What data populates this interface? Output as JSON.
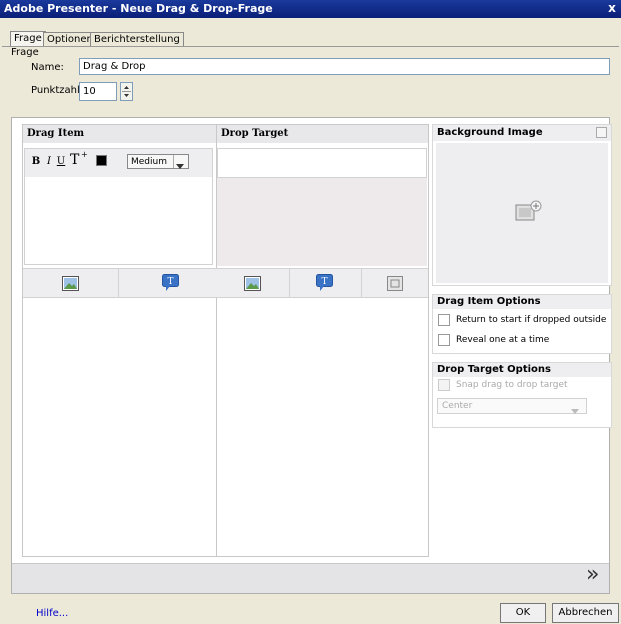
{
  "window": {
    "title": "Adobe Presenter - Neue Drag & Drop-Frage",
    "close_glyph": "x"
  },
  "tabs": [
    {
      "label": "Frage"
    },
    {
      "label": "Optionen"
    },
    {
      "label": "Berichterstellung"
    }
  ],
  "frage_group": {
    "legend": "Frage",
    "name_label": "Name:",
    "name_value": "Drag & Drop",
    "punkt_label": "Punktzahl:",
    "punkt_value": "10"
  },
  "drag_item": {
    "header": "Drag Item",
    "bold": "B",
    "italic": "I",
    "underline": "U",
    "textsize": "T",
    "textsize_sup": "+",
    "size_value": "Medium"
  },
  "drop_target": {
    "header": "Drop Target"
  },
  "right": {
    "bg_header": "Background Image",
    "drag_options_header": "Drag Item Options",
    "return_label": "Return to start if dropped outside",
    "reveal_label": "Reveal one at a time",
    "drop_options_header": "Drop Target Options",
    "snap_label": "Snap drag to drop target",
    "align_value": "Center"
  },
  "nav": {
    "next_glyph": "»"
  },
  "footer": {
    "help": "Hilfe...",
    "ok": "OK",
    "cancel": "Abbrechen"
  },
  "colors": {
    "title_bg": "#0a1f78",
    "help_link": "#0000cc",
    "icon_green": "#5b9a4a",
    "icon_blue": "#3a73c6"
  }
}
